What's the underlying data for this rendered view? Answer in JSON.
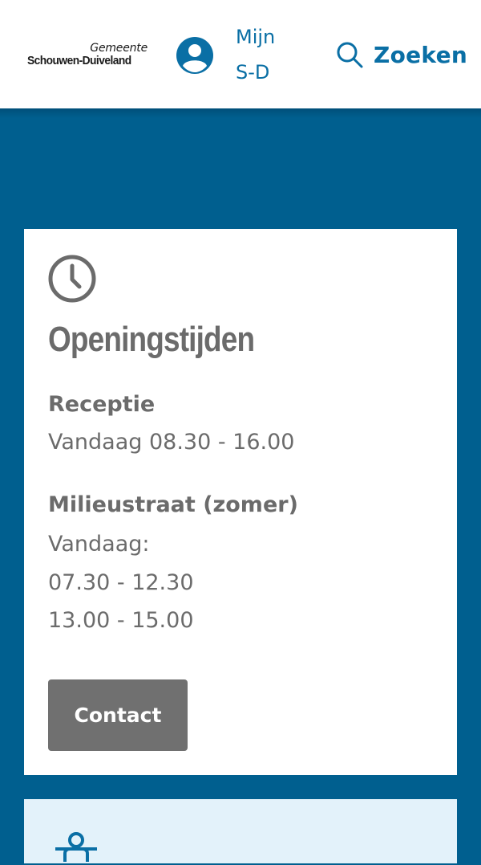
{
  "header": {
    "logo": {
      "line1": "Gemeente",
      "line2": "Schouwen-Duiveland"
    },
    "account_icon": "user-circle-icon",
    "mijn_line1": "Mijn",
    "mijn_line2": "S-D",
    "search_icon": "search-icon",
    "search_label": "Zoeken"
  },
  "card": {
    "icon": "clock-icon",
    "title": "Openingstijden",
    "sections": [
      {
        "label": "Receptie",
        "lines": [
          "Vandaag 08.30 - 16.00"
        ]
      },
      {
        "label": "Milieustraat (zomer)",
        "lines": [
          "Vandaag:",
          "07.30 - 12.30",
          "13.00 - 15.00"
        ]
      }
    ],
    "button_label": "Contact"
  },
  "card2": {
    "icon": "briefcase-person-icon"
  },
  "colors": {
    "header_bg": "#ffffff",
    "band_bg": "#005f8f",
    "link_blue": "#0a6fa5",
    "text_gray": "#6b6b6b",
    "button_gray": "#707070",
    "card2_bg": "#e3f2fa"
  }
}
